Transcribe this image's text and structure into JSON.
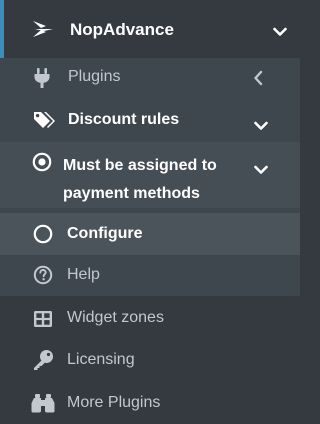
{
  "menu": {
    "brand": {
      "label": "NopAdvance",
      "icon": "nopadvance-logo-icon",
      "expanded": true
    },
    "plugins": {
      "label": "Plugins",
      "icon": "plug-icon",
      "expanded": false
    },
    "discount_rules": {
      "label": "Discount rules",
      "icon": "tags-icon",
      "expanded": true
    },
    "must_be_assigned": {
      "label": "Must be assigned to payment methods",
      "icon": "dot-circle-icon",
      "expanded": true
    },
    "configure": {
      "label": "Configure",
      "icon": "circle-icon",
      "active": true
    },
    "help": {
      "label": "Help",
      "icon": "question-circle-icon"
    },
    "widget_zones": {
      "label": "Widget zones",
      "icon": "th-large-icon"
    },
    "licensing": {
      "label": "Licensing",
      "icon": "key-icon"
    },
    "more_plugins": {
      "label": "More Plugins",
      "icon": "binoculars-icon"
    }
  },
  "colors": {
    "sidebar_bg": "#343a40",
    "submenu_bg": "#3f474e",
    "active_bg": "#4b535b",
    "accent": "#3c8dbc",
    "text_muted": "#c2c7d0",
    "text_bright": "#ffffff"
  }
}
